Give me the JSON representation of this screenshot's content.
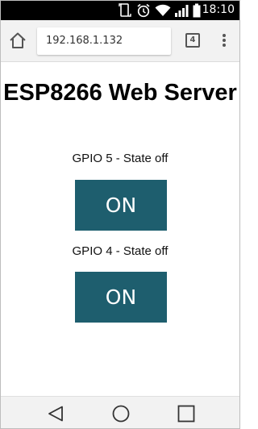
{
  "status_bar": {
    "time": "18:10",
    "icons": [
      "screenshot-icon",
      "alarm-icon",
      "wifi-icon",
      "signal-icon",
      "battery-icon"
    ]
  },
  "browser": {
    "url": "192.168.1.132",
    "tab_count": "4"
  },
  "page": {
    "title": "ESP8266 Web Server",
    "gpio": [
      {
        "label": "GPIO 5 - State off",
        "button": "ON"
      },
      {
        "label": "GPIO 4 - State off",
        "button": "ON"
      }
    ]
  },
  "colors": {
    "button_bg": "#1e5e6e",
    "button_text": "#ffffff"
  },
  "nav_bar": {
    "icons": [
      "back-icon",
      "home-icon",
      "recents-icon"
    ]
  }
}
